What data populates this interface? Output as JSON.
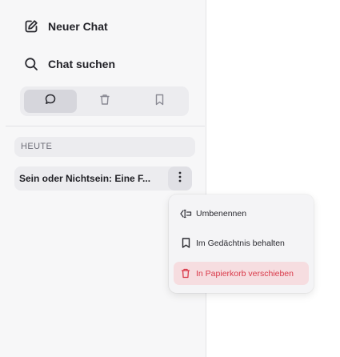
{
  "sidebar": {
    "new_chat_label": "Neuer Chat",
    "search_chat_label": "Chat suchen",
    "section_label": "HEUTE",
    "chat_title": "Sein oder Nichtsein: Eine F..."
  },
  "context_menu": {
    "rename_label": "Umbenennen",
    "remember_label": "Im Gedächtnis behalten",
    "trash_label": "In Papierkorb verschieben"
  },
  "colors": {
    "danger": "#d93a4a",
    "danger_bg": "#f6dde0"
  }
}
